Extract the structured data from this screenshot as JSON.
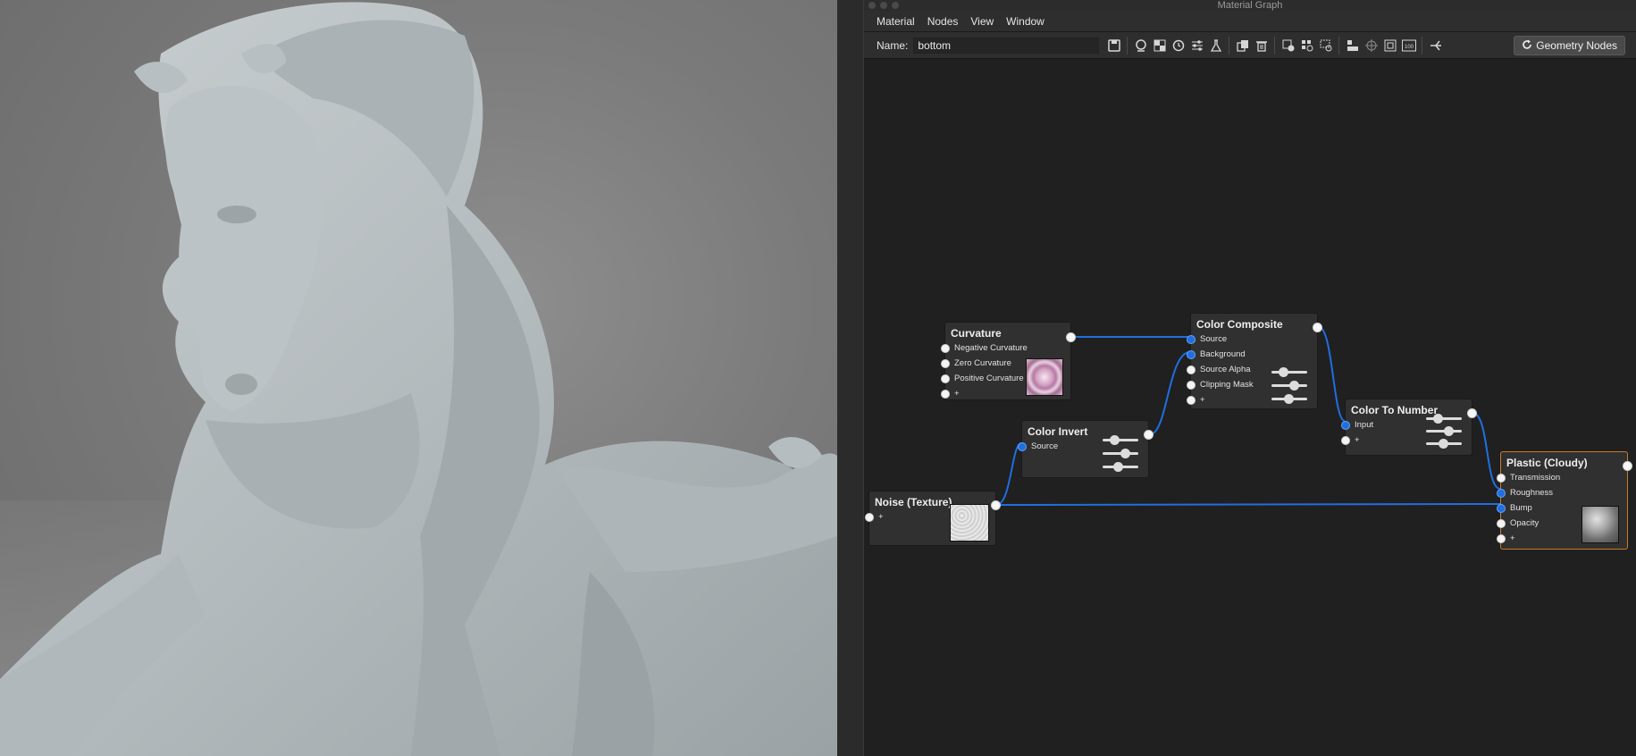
{
  "window": {
    "title": "Material Graph"
  },
  "menubar": {
    "items": [
      "Material",
      "Nodes",
      "View",
      "Window"
    ]
  },
  "toolbar": {
    "name_label": "Name:",
    "name_value": "bottom",
    "geometry_nodes_label": "Geometry Nodes",
    "icons": [
      "save-icon",
      "material-ball-icon",
      "checker-icon",
      "history-icon",
      "sliders-icon",
      "lab-flask-icon",
      "duplicate-icon",
      "trash-icon",
      "add-node-icon",
      "node-grid-icon",
      "node-dotted-icon",
      "align-icon",
      "center-icon",
      "fit-view-icon",
      "zoom-100-icon",
      "split-icon"
    ],
    "zoom_label": "100"
  },
  "nodes": {
    "curvature": {
      "title": "Curvature",
      "ports": [
        "Negative Curvature",
        "Zero Curvature",
        "Positive Curvature",
        "+"
      ]
    },
    "color_composite": {
      "title": "Color Composite",
      "ports": [
        "Source",
        "Background",
        "Source Alpha",
        "Clipping Mask",
        "+"
      ]
    },
    "color_invert": {
      "title": "Color Invert",
      "ports": [
        "Source"
      ]
    },
    "color_to_number": {
      "title": "Color To Number",
      "ports": [
        "Input",
        "+"
      ]
    },
    "noise_texture": {
      "title": "Noise (Texture)",
      "ports": [
        "+"
      ]
    },
    "plastic_cloudy": {
      "title": "Plastic (Cloudy)",
      "ports": [
        "Transmission",
        "Roughness",
        "Bump",
        "Opacity",
        "+"
      ]
    }
  },
  "colors": {
    "wire": "#1f6fe0",
    "selected_border": "#c87c2a",
    "canvas": "#202020"
  }
}
